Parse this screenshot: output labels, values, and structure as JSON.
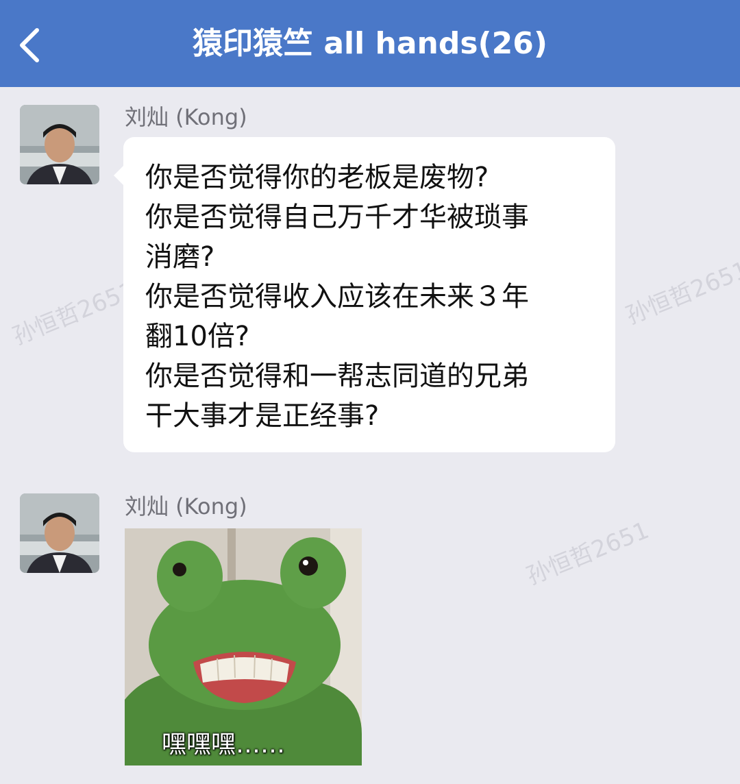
{
  "header": {
    "title": "猿印猿竺 all hands(26)",
    "back_icon": "chevron-left-icon",
    "background": "#4a78c8"
  },
  "watermark": "孙恒哲2651",
  "messages": [
    {
      "sender": "刘灿 (Kong)",
      "type": "text",
      "lines": [
        "你是否觉得你的老板是废物?",
        "你是否觉得自己万千才华被琐事",
        "消磨?",
        "你是否觉得收入应该在未来３年",
        "翻10倍?",
        "你是否觉得和一帮志同道的兄弟",
        "干大事才是正经事?"
      ]
    },
    {
      "sender": "刘灿 (Kong)",
      "type": "sticker",
      "caption": "嘿嘿嘿……"
    }
  ]
}
